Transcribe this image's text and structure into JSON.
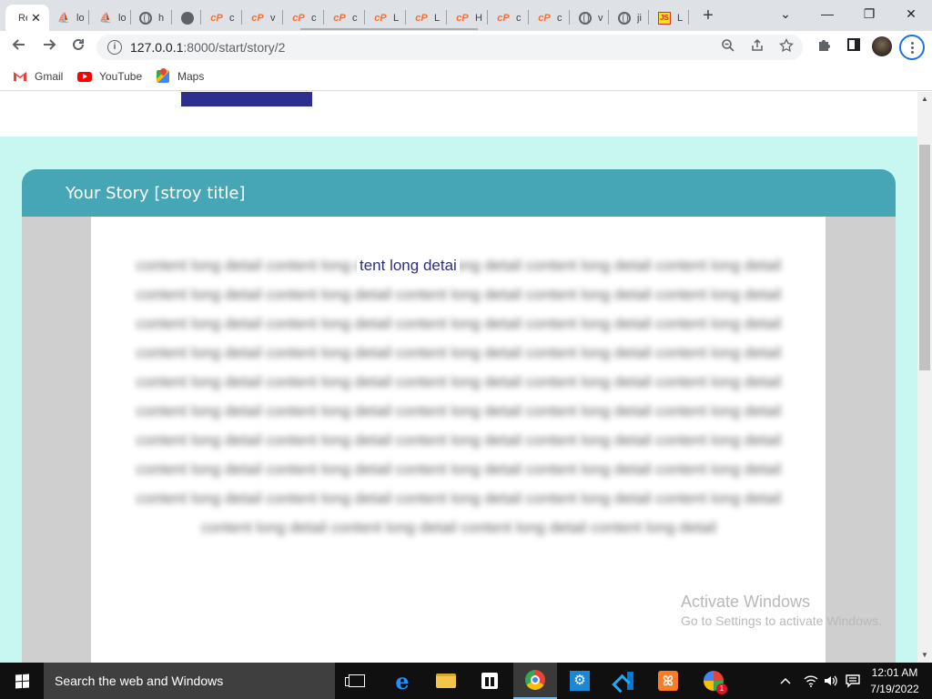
{
  "browser": {
    "tabs": [
      {
        "label": "Re",
        "icon": "globe-icon",
        "active": true
      },
      {
        "label": "lo",
        "icon": "phpmyadmin-icon"
      },
      {
        "label": "lo",
        "icon": "phpmyadmin-icon"
      },
      {
        "label": "h",
        "icon": "globe-icon"
      },
      {
        "label": "",
        "icon": "circle-icon"
      },
      {
        "label": "c",
        "icon": "cpanel-icon"
      },
      {
        "label": "v",
        "icon": "cpanel-icon"
      },
      {
        "label": "c",
        "icon": "cpanel-icon"
      },
      {
        "label": "c",
        "icon": "cpanel-icon"
      },
      {
        "label": "L",
        "icon": "cpanel-icon"
      },
      {
        "label": "L",
        "icon": "cpanel-icon"
      },
      {
        "label": "H",
        "icon": "cpanel-icon"
      },
      {
        "label": "c",
        "icon": "cpanel-icon"
      },
      {
        "label": "c",
        "icon": "cpanel-icon"
      },
      {
        "label": "v",
        "icon": "globe-icon"
      },
      {
        "label": "ji",
        "icon": "globe-icon"
      },
      {
        "label": "L",
        "icon": "js-icon"
      }
    ],
    "new_tab": "+",
    "window_controls": {
      "tab_search": "⌄",
      "minimize": "—",
      "restore": "❐",
      "close": "✕"
    },
    "url_scheme_host": "127.0.0.1",
    "url_path": ":8000/start/story/2",
    "bookmarks": [
      {
        "label": "Gmail",
        "icon": "gmail-icon"
      },
      {
        "label": "YouTube",
        "icon": "youtube-icon"
      },
      {
        "label": "Maps",
        "icon": "maps-icon"
      }
    ]
  },
  "page": {
    "story_title": "Your Story [stroy title]",
    "story_text": "content long detail content long detail content long detail content long detail content long detail content long detail content long detail content long detail content long detail content long detail content long detail content long detail content long detail content long detail content long detail content long detail content long detail content long detail content long detail content long detail content long detail content long detail content long detail content long detail content long detail content long detail content long detail content long detail content long detail content long detail content long detail content long detail content long detail content long detail content long detail content long detail content long detail content long detail content long detail content long detail content long detail content long detail content long detail content long detail content long detail content long detail content long detail content long detail content long detail",
    "revealed_text": "tent long detai"
  },
  "watermark": {
    "line1": "Activate Windows",
    "line2": "Go to Settings to activate Windows."
  },
  "taskbar": {
    "search_placeholder": "Search the web and Windows",
    "time": "12:01 AM",
    "date": "7/19/2022",
    "notification_badge": "1"
  }
}
